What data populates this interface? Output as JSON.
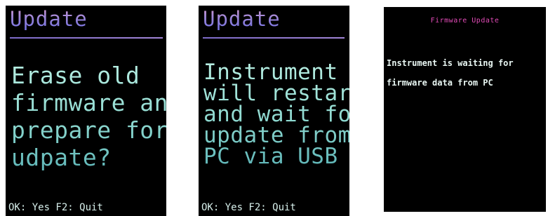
{
  "screens": [
    {
      "title": "Update",
      "message_lines": [
        "Erase old",
        "firmware and",
        "prepare for",
        "udpate?"
      ],
      "footer": "OK: Yes  F2: Quit"
    },
    {
      "title": "Update",
      "message_lines": [
        "Instrument",
        "will restart",
        "and wait for",
        "update from",
        "PC via USB"
      ],
      "footer": "OK: Yes  F2: Quit"
    },
    {
      "title": "Firmware Update",
      "message_lines": [
        "Instrument is waiting for",
        "firmware data from PC"
      ]
    }
  ],
  "colors": {
    "screen_bg": "#000000",
    "title_purple": "#9b86d8",
    "message_teal": "#8ed9d0",
    "fw_title_magenta": "#e24bb7",
    "fw_text": "#e9f7f3"
  }
}
